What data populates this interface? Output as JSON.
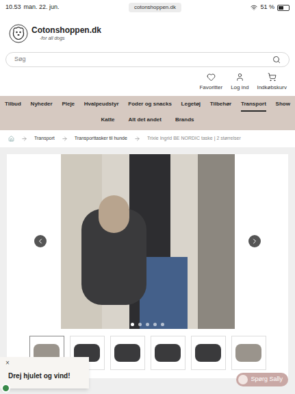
{
  "status_bar": {
    "time": "10.53",
    "date": "man. 22. jun.",
    "url": "cotonshoppen.dk",
    "battery": "51 %",
    "battery_level": 0.51
  },
  "logo": {
    "name": "Cotonshoppen.dk",
    "tagline": "-for all dogs"
  },
  "search": {
    "placeholder": "Søg"
  },
  "actions": [
    "Favoritter",
    "Log ind",
    "Indkøbskurv"
  ],
  "nav": {
    "row1": [
      {
        "label": "Tilbud",
        "selected": false
      },
      {
        "label": "Nyheder",
        "selected": false
      },
      {
        "label": "Pleje",
        "selected": false
      },
      {
        "label": "Hvalpeudstyr",
        "selected": false
      },
      {
        "label": "Foder og snacks",
        "selected": false
      },
      {
        "label": "Legetøj",
        "selected": false
      },
      {
        "label": "Tilbehør",
        "selected": false
      },
      {
        "label": "Transport",
        "selected": true
      },
      {
        "label": "Show",
        "selected": false
      }
    ],
    "row2": [
      {
        "label": "Katte",
        "selected": false
      },
      {
        "label": "Alt det andet",
        "selected": false
      },
      {
        "label": "Brands",
        "selected": false
      }
    ]
  },
  "breadcrumb": [
    {
      "label": "Transport",
      "current": false
    },
    {
      "label": "Transporttasker til hunde",
      "current": false
    },
    {
      "label": "Trixie Ingrid BE NORDIC taske | 2 størrelser",
      "current": true
    }
  ],
  "gallery": {
    "dots": [
      {
        "selected": true
      },
      {
        "selected": false
      },
      {
        "selected": false
      },
      {
        "selected": false
      },
      {
        "selected": false
      }
    ],
    "thumbnails": [
      {
        "selected": true
      },
      {
        "selected": false
      },
      {
        "selected": false
      },
      {
        "selected": false
      },
      {
        "selected": false
      },
      {
        "selected": false
      }
    ]
  },
  "popup": {
    "text": "Drej hjulet og vind!",
    "close": "×"
  },
  "chat": {
    "label": "Spørg Sally"
  }
}
